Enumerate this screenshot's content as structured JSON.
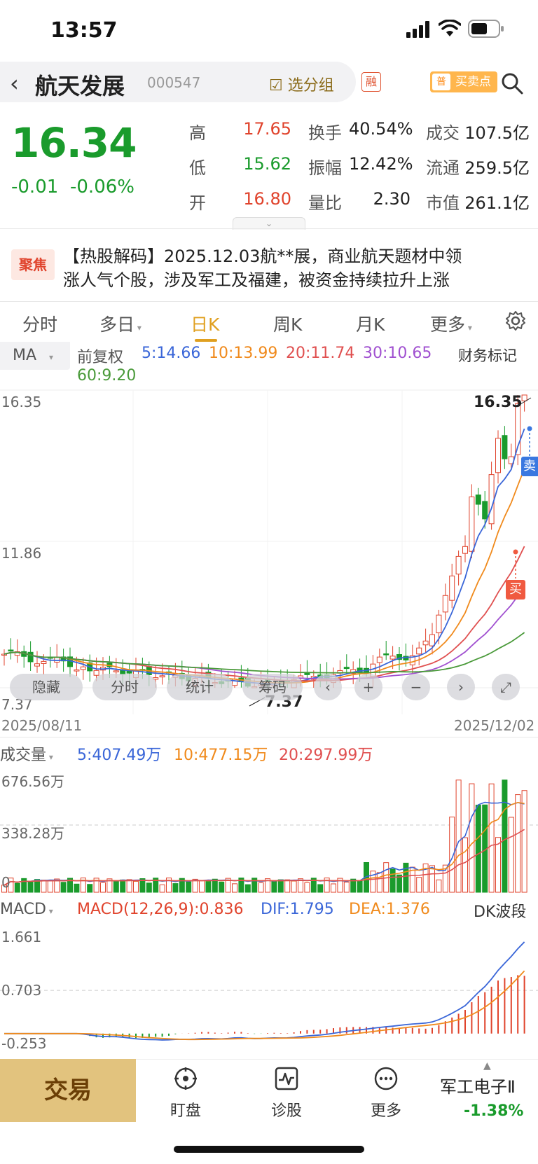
{
  "status_bar": {
    "time": "13:57"
  },
  "header": {
    "stock_name": "航天发展",
    "stock_code": "000547",
    "group_btn": "选分组",
    "rong_badge": "融",
    "buysell_badge": "普",
    "buysell_label": "买卖点"
  },
  "quote": {
    "price": "16.34",
    "change": "-0.01",
    "change_pct": "-0.06%",
    "rows": [
      {
        "l1": "高",
        "v1": "17.65",
        "l2": "换手",
        "v2": "40.54%",
        "l3": "成交",
        "v3": "107.5亿"
      },
      {
        "l1": "低",
        "v1": "15.62",
        "l2": "振幅",
        "v2": "12.42%",
        "l3": "流通",
        "v3": "259.5亿"
      },
      {
        "l1": "开",
        "v1": "16.80",
        "l2": "量比",
        "v2": "2.30",
        "l3": "市值",
        "v3": "261.1亿"
      }
    ]
  },
  "news": {
    "badge": "聚焦",
    "line1": "【热股解码】2025.12.03航**展，商业航天题材中领",
    "line2": "涨人气个股，涉及军工及福建，被资金持续拉升上涨"
  },
  "tabs": [
    "分时",
    "多日",
    "日K",
    "周K",
    "月K",
    "更多"
  ],
  "active_tab": "日K",
  "ma_row": {
    "label": "MA",
    "adjust": "前复权",
    "ma5": "5:14.66",
    "ma10": "10:13.99",
    "ma20": "20:11.74",
    "ma30": "30:10.65",
    "ma60": "60:9.20",
    "fin_mark": "财务标记"
  },
  "kline": {
    "y_top": "16.35",
    "y_mid": "11.86",
    "y_bot": "7.37",
    "high_label": "16.35",
    "low_label": "7.37",
    "sell_tag": "卖",
    "buy_tag": "买",
    "date_start": "2025/08/11",
    "date_end": "2025/12/02"
  },
  "overlay_buttons": {
    "hide": "隐藏",
    "fenshi": "分时",
    "stats": "统计",
    "chips": "筹码"
  },
  "volume": {
    "title": "成交量",
    "ma5": "5:407.49万",
    "ma10": "10:477.15万",
    "ma20": "20:297.99万",
    "y_top": "676.56万",
    "y_mid": "338.28万",
    "y_bot": "0"
  },
  "macd": {
    "title": "MACD",
    "params": "MACD(12,26,9):0.836",
    "dif": "DIF:1.795",
    "dea": "DEA:1.376",
    "dk_btn": "DK波段",
    "y_top": "1.661",
    "y_mid": "0.703",
    "y_bot": "-0.253"
  },
  "bottom_bar": {
    "trade": "交易",
    "watch": "盯盘",
    "diagnose": "诊股",
    "more": "更多",
    "sector_name": "军工电子Ⅱ",
    "sector_change": "-1.38%"
  },
  "colors": {
    "up": "#e0432c",
    "down": "#1a9b2c",
    "ma5": "#3a66d8",
    "ma10": "#f08a1c",
    "ma20": "#e05050",
    "ma30": "#a050d0",
    "ma60": "#4a9a3a",
    "accent": "#e0a020"
  }
}
